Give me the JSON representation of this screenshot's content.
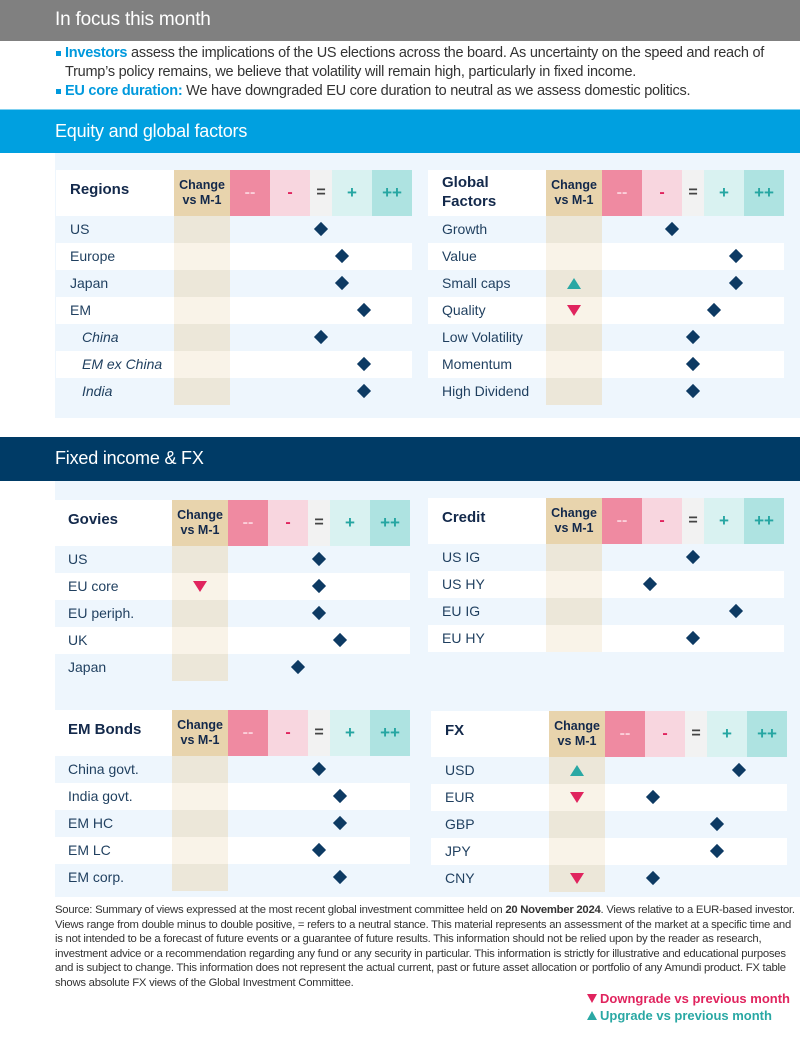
{
  "focus": {
    "title": "In focus this month",
    "bullets": [
      {
        "highlight": "Investors",
        "text": " assess the implications of the US elections across the board. As uncertainty on the speed and reach of Trump’s policy remains, we believe that volatility will remain high, particularly in fixed income."
      },
      {
        "highlight": "EU core duration:",
        "text": " We have downgraded EU core duration to neutral as we assess domestic politics."
      }
    ]
  },
  "sections": {
    "equity_title": "Equity and global factors",
    "fixed_income_title": "Fixed income & FX"
  },
  "scale_headers": {
    "change": "Change vs M-1",
    "double_minus": "--",
    "minus": "-",
    "neutral": "=",
    "plus": "+",
    "double_plus": "++"
  },
  "chart_data": {
    "type": "table",
    "scale": "views from -2 (double minus) to +2 (double plus), 0 = neutral; half steps between columns",
    "tables": [
      {
        "title": "Regions",
        "rows": [
          {
            "label": "US",
            "view": 0,
            "change": null,
            "italic": false
          },
          {
            "label": "Europe",
            "view": 0.5,
            "change": null,
            "italic": false
          },
          {
            "label": "Japan",
            "view": 0.5,
            "change": null,
            "italic": false
          },
          {
            "label": "EM",
            "view": 1,
            "change": null,
            "italic": false
          },
          {
            "label": "China",
            "view": 0,
            "change": null,
            "italic": true
          },
          {
            "label": "EM ex China",
            "view": 1,
            "change": null,
            "italic": true
          },
          {
            "label": "India",
            "view": 1,
            "change": null,
            "italic": true
          }
        ]
      },
      {
        "title": "Global Factors",
        "rows": [
          {
            "label": "Growth",
            "view": -0.5,
            "change": null
          },
          {
            "label": "Value",
            "view": 1,
            "change": null
          },
          {
            "label": "Small caps",
            "view": 1,
            "change": "up"
          },
          {
            "label": "Quality",
            "view": 0.5,
            "change": "down"
          },
          {
            "label": "Low Volatility",
            "view": 0,
            "change": null
          },
          {
            "label": "Momentum",
            "view": 0,
            "change": null
          },
          {
            "label": "High Dividend",
            "view": 0,
            "change": null
          }
        ]
      },
      {
        "title": "Govies",
        "rows": [
          {
            "label": "US",
            "view": 0,
            "change": null
          },
          {
            "label": "EU core",
            "view": 0,
            "change": "down"
          },
          {
            "label": "EU periph.",
            "view": 0,
            "change": null
          },
          {
            "label": "UK",
            "view": 0.5,
            "change": null
          },
          {
            "label": "Japan",
            "view": -0.5,
            "change": null
          }
        ]
      },
      {
        "title": "Credit",
        "rows": [
          {
            "label": "US IG",
            "view": 0,
            "change": null
          },
          {
            "label": "US HY",
            "view": -1,
            "change": null
          },
          {
            "label": "EU IG",
            "view": 1,
            "change": null
          },
          {
            "label": "EU HY",
            "view": 0,
            "change": null
          }
        ]
      },
      {
        "title": "EM Bonds",
        "rows": [
          {
            "label": "China govt.",
            "view": 0,
            "change": null
          },
          {
            "label": "India govt.",
            "view": 0.5,
            "change": null
          },
          {
            "label": "EM HC",
            "view": 0.5,
            "change": null
          },
          {
            "label": "EM LC",
            "view": 0,
            "change": null
          },
          {
            "label": "EM corp.",
            "view": 0.5,
            "change": null
          }
        ]
      },
      {
        "title": "FX",
        "rows": [
          {
            "label": "USD",
            "view": 1,
            "change": "up"
          },
          {
            "label": "EUR",
            "view": -1,
            "change": "down"
          },
          {
            "label": "GBP",
            "view": 0.5,
            "change": null
          },
          {
            "label": "JPY",
            "view": 0.5,
            "change": null
          },
          {
            "label": "CNY",
            "view": -1,
            "change": "down"
          }
        ]
      }
    ]
  },
  "source": {
    "prefix": "Source: Summary of views expressed at the most recent global investment committee held on ",
    "date": "20 November 2024",
    "suffix": ". Views relative to a EUR-based investor. Views range from double minus to double positive, = refers to a neutral stance. This material represents an assessment of the market at a specific time and is not intended to be a forecast of future events or a guarantee of future results. This information should not be relied upon by the reader as research, investment advice or a recommendation regarding any fund or any security in particular. This information is strictly for illustrative and educational purposes and is subject to change. This information does not represent the actual current, past or future asset allocation or portfolio of any Amundi product. FX table shows absolute FX views of the Global Investment Committee."
  },
  "legend": {
    "downgrade": "Downgrade vs previous month",
    "upgrade": "Upgrade vs previous month"
  },
  "colors": {
    "equity_bar": "#00a0e0",
    "fixed_income_bar": "#003b66",
    "downgrade": "#e0245e",
    "upgrade": "#2aa8a4",
    "diamond": "#0d3a63"
  }
}
